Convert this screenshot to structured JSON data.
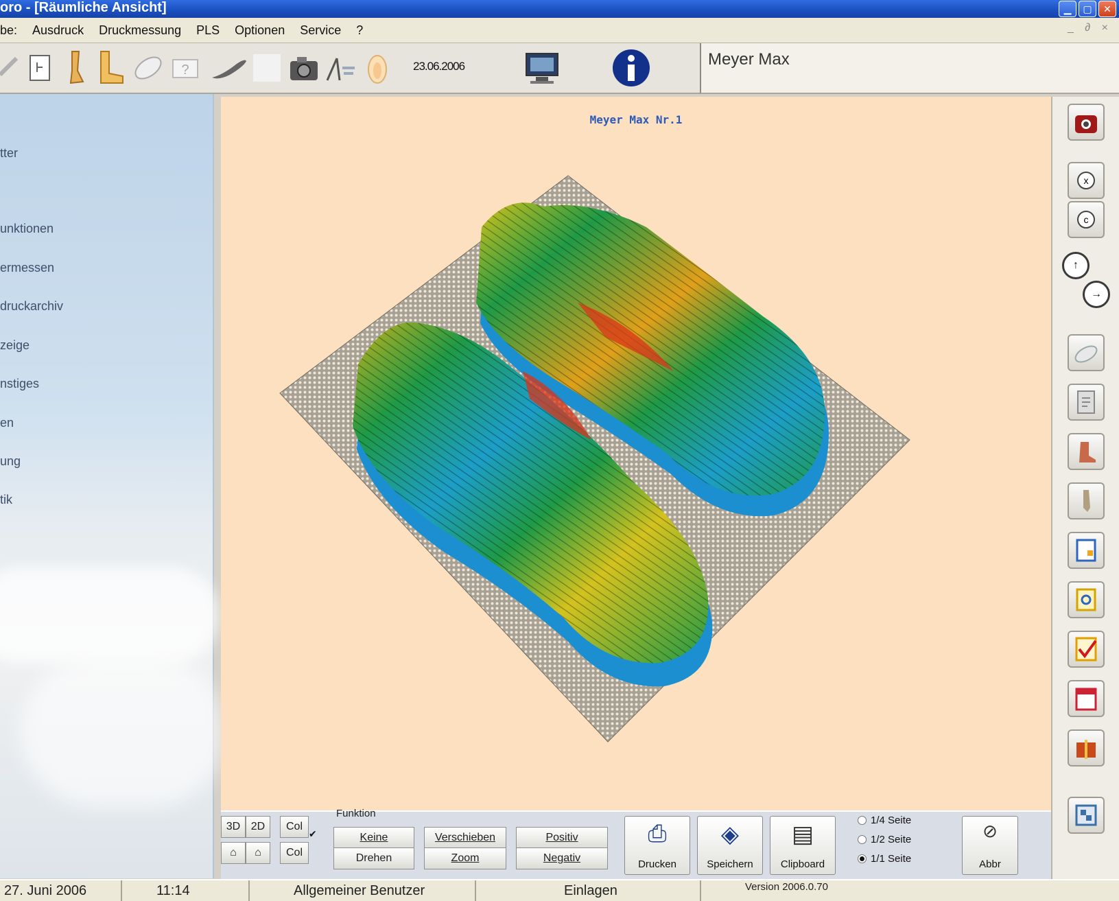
{
  "window": {
    "title": "oro - [Räumliche Ansicht]",
    "buttons": [
      "minimize-icon",
      "maximize-icon",
      "close-icon"
    ]
  },
  "menubar": {
    "items": [
      "be:",
      "Ausdruck",
      "Druckmessung",
      "PLS",
      "Optionen",
      "Service",
      "?"
    ],
    "mdi_controls": "_ ∂ ×"
  },
  "toolbar": {
    "date": "23.06.2006",
    "icons": [
      "new-document-icon",
      "foot-blueprint-icon",
      "leg-icon",
      "boot-icon",
      "insole-icon",
      "question-icon",
      "sole-profile-icon",
      "blank-icon",
      "camera-icon",
      "measure-foot-icon",
      "footprint-icon",
      "monitor-icon",
      "info-icon"
    ]
  },
  "patient": {
    "name": "Meyer Max"
  },
  "sidebar": {
    "items": [
      "tter",
      "unktionen",
      "ermessen",
      "druckarchiv",
      "zeige",
      "nstiges",
      "en",
      "ung",
      "tik"
    ]
  },
  "view": {
    "title": "Meyer Max Nr.1",
    "plot": {
      "type": "3d-surface",
      "description_colors": [
        "#1a5fc8",
        "#1aa0c8",
        "#1fa04a",
        "#c9c21a",
        "#e08a1a",
        "#d8341a"
      ],
      "plane_color": "#8e8a80"
    }
  },
  "right_tools": {
    "icons": [
      "camera-icon",
      "rotate-x-icon",
      "rotate-c-icon",
      "zoom-in-icon",
      "zoom-out-icon",
      "insole-icon",
      "page-icon",
      "foot-side-icon",
      "foot-back-icon",
      "note-icon",
      "search-page-icon",
      "checkmark-icon",
      "calendar-icon",
      "gift-icon",
      "exit-icon"
    ]
  },
  "controls": {
    "view_3d": "3D",
    "view_2d": "2D",
    "col1": "Col",
    "col2": "Col",
    "group_label": "Funktion",
    "keine": "Keine",
    "drehen": "Drehen",
    "verschieben": "Verschieben",
    "zoom": "Zoom",
    "positiv": "Positiv",
    "negativ": "Negativ",
    "drucken": "Drucken",
    "speichern": "Speichern",
    "clipboard": "Clipboard",
    "radios": [
      {
        "label": "1/4 Seite",
        "selected": false
      },
      {
        "label": "1/2 Seite",
        "selected": false
      },
      {
        "label": "1/1 Seite",
        "selected": true
      }
    ],
    "abbrechen": "Abbr"
  },
  "statusbar": {
    "date": "27. Juni 2006",
    "time": "11:14",
    "user": "Allgemeiner Benutzer",
    "mode": "Einlagen",
    "version": "Version 2006.0.70"
  }
}
